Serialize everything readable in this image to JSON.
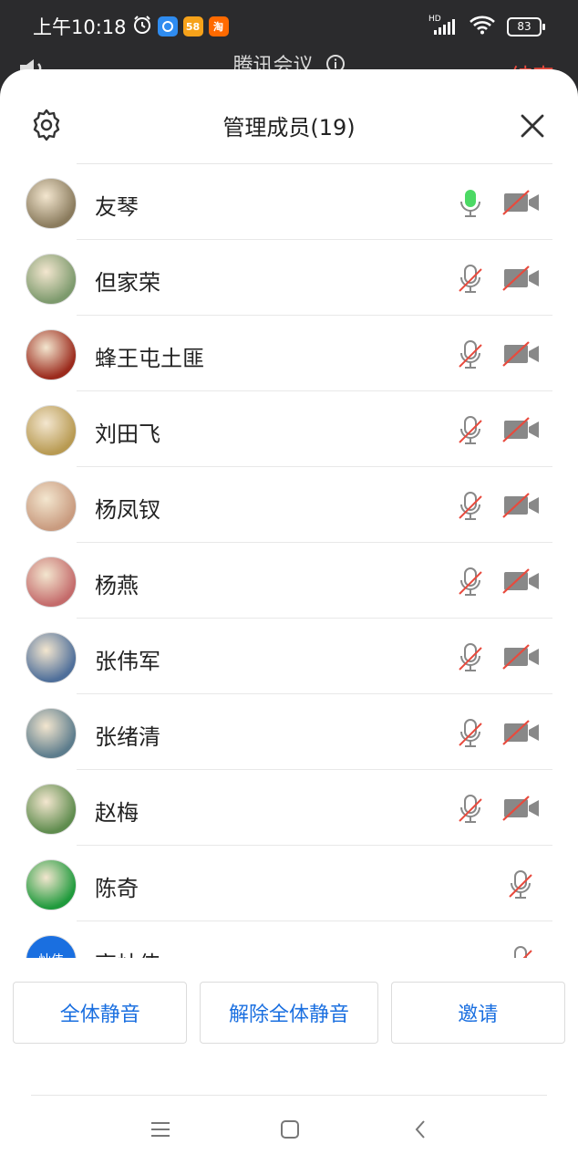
{
  "status_bar": {
    "time": "上午10:18",
    "app_badges": [
      "qq-browser-icon",
      "58",
      "淘"
    ],
    "network_label": "HD",
    "battery": "83"
  },
  "meeting_bar": {
    "title": "腾讯会议",
    "end_label": "结束"
  },
  "panel": {
    "title": "管理成员(19)"
  },
  "members": [
    {
      "name": "友琴",
      "mic": "speaking",
      "camera": "off",
      "avatar_color": "#8a7b5d"
    },
    {
      "name": "但家荣",
      "mic": "muted",
      "camera": "off",
      "avatar_color": "#7d9a6d"
    },
    {
      "name": "蜂王屯土匪",
      "mic": "muted",
      "camera": "off",
      "avatar_color": "#9b2a1c"
    },
    {
      "name": "刘田飞",
      "mic": "muted",
      "camera": "off",
      "avatar_color": "#b89a52"
    },
    {
      "name": "杨凤钗",
      "mic": "muted",
      "camera": "off",
      "avatar_color": "#c99b7f"
    },
    {
      "name": "杨燕",
      "mic": "muted",
      "camera": "off",
      "avatar_color": "#c46b6b"
    },
    {
      "name": "张伟军",
      "mic": "muted",
      "camera": "off",
      "avatar_color": "#4f6f9a"
    },
    {
      "name": "张绪清",
      "mic": "muted",
      "camera": "off",
      "avatar_color": "#5c7c8c"
    },
    {
      "name": "赵梅",
      "mic": "muted",
      "camera": "off",
      "avatar_color": "#5f8c4e"
    },
    {
      "name": "陈奇",
      "mic": "muted",
      "camera": "none",
      "avatar_color": "#1f9a3c"
    },
    {
      "name": "高灿伟",
      "mic": "muted",
      "camera": "none",
      "avatar_color": "#1a6fe0",
      "avatar_text": "灿伟"
    }
  ],
  "actions": {
    "mute_all": "全体静音",
    "unmute_all": "解除全体静音",
    "invite": "邀请"
  },
  "colors": {
    "accent": "#1a6fe0",
    "muted_slash": "#e84a3d",
    "speaking": "#4cd964",
    "end": "#e84a3d"
  }
}
